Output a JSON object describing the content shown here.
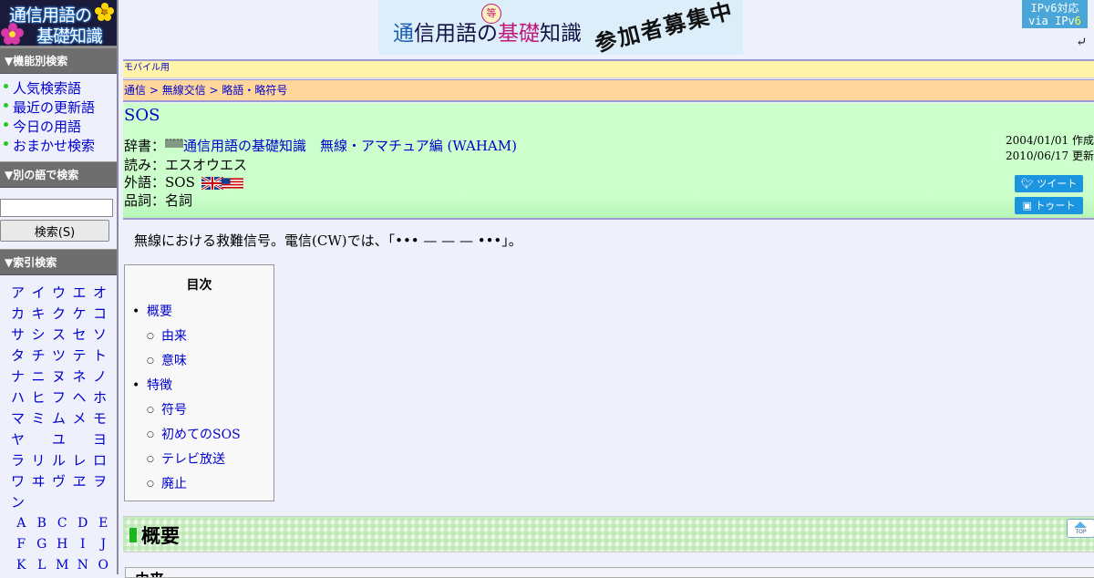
{
  "logo": {
    "line1": "通信用語の",
    "line2": "基礎知識"
  },
  "sidebar": {
    "feature_head": "▼機能別検索",
    "feature_items": [
      "人気検索語",
      "最近の更新語",
      "今日の用語",
      "おまかせ検索"
    ],
    "search_head": "▼別の語で検索",
    "search_button": "検索(S)",
    "index_head": "▼索引検索",
    "kana_rows": [
      [
        "ア",
        "イ",
        "ウ",
        "エ",
        "オ"
      ],
      [
        "カ",
        "キ",
        "ク",
        "ケ",
        "コ"
      ],
      [
        "サ",
        "シ",
        "ス",
        "セ",
        "ソ"
      ],
      [
        "タ",
        "チ",
        "ツ",
        "テ",
        "ト"
      ],
      [
        "ナ",
        "ニ",
        "ヌ",
        "ネ",
        "ノ"
      ],
      [
        "ハ",
        "ヒ",
        "フ",
        "ヘ",
        "ホ"
      ],
      [
        "マ",
        "ミ",
        "ム",
        "メ",
        "モ"
      ],
      [
        "ヤ",
        "",
        "ユ",
        "",
        "ヨ"
      ],
      [
        "ラ",
        "リ",
        "ル",
        "レ",
        "ロ"
      ],
      [
        "ワ",
        "ヰ",
        "ヴ",
        "ヱ",
        "ヲ"
      ],
      [
        "ン",
        "",
        "",
        "",
        ""
      ]
    ],
    "abc_rows": [
      [
        "A",
        "B",
        "C",
        "D",
        "E"
      ],
      [
        "F",
        "G",
        "H",
        "I",
        "J"
      ],
      [
        "K",
        "L",
        "M",
        "N",
        "O"
      ]
    ]
  },
  "banner": {
    "a": "通",
    "b": "信",
    "c": "用語の",
    "d": "基礎",
    "e": "知識",
    "tou": "等",
    "recruit": "参加者募集中"
  },
  "ipv6": {
    "line1": "IPv6対応",
    "line2a": "via IPv",
    "line2b": "6"
  },
  "mobile_bar": "モバイル用",
  "breadcrumb": {
    "c1": "通信",
    "sep": " > ",
    "c2": "無線交信",
    "c3": "略語・略符号"
  },
  "term": {
    "title": "SOS",
    "dict_label": "辞書：",
    "dict_link": "通信用語の基礎知識　無線・アマチュア編 (WAHAM)",
    "reading_label": "読み：",
    "reading": "エスオウエス",
    "foreign_label": "外語：",
    "foreign": "SOS",
    "pos_label": "品詞：",
    "pos": "名詞",
    "created": "2004/01/01 作成",
    "updated": "2010/06/17 更新",
    "tweet": "ツイート",
    "toot": "トゥート"
  },
  "summary": "無線における救難信号。電信(CW)では、「••• — — — •••」。",
  "toc": {
    "title": "目次",
    "items": [
      {
        "label": "概要",
        "level": 1
      },
      {
        "label": "由来",
        "level": 2
      },
      {
        "label": "意味",
        "level": 2
      },
      {
        "label": "特徴",
        "level": 1
      },
      {
        "label": "符号",
        "level": 2
      },
      {
        "label": "初めてのSOS",
        "level": 2
      },
      {
        "label": "テレビ放送",
        "level": 2
      },
      {
        "label": "廃止",
        "level": 2
      }
    ]
  },
  "section": {
    "heading": "概要",
    "top_label": "TOP",
    "next_heading": "由来"
  },
  "colors": {
    "info_bg": "#ccffcc",
    "breadcrumb_bg": "#ffd69b",
    "mobile_bg": "#fff4a8",
    "link": "#0000cc"
  }
}
